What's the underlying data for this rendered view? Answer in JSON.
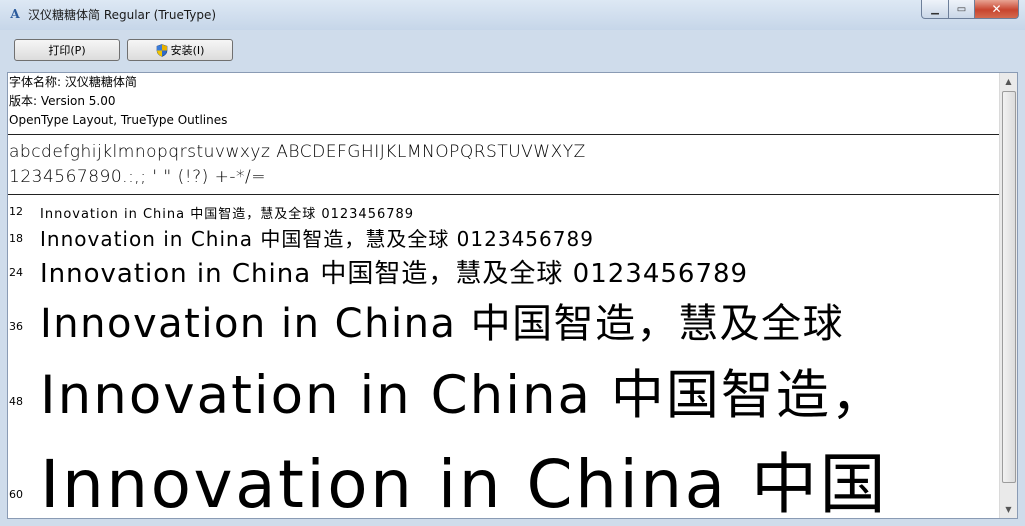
{
  "window": {
    "title": "汉仪糖糖体简 Regular (TrueType)",
    "minimize_glyph": "▁",
    "maximize_glyph": "▭",
    "close_glyph": "✕"
  },
  "toolbar": {
    "print_label": "打印(P)",
    "install_label": "安装(I)"
  },
  "info": {
    "font_name": "字体名称: 汉仪糖糖体简",
    "version": "版本: Version 5.00",
    "outlines": "OpenType Layout, TrueType Outlines"
  },
  "charset": {
    "line1": "abcdefghijklmnopqrstuvwxyz ABCDEFGHIJKLMNOPQRSTUVWXYZ",
    "line2": "1234567890.:,; ' \" (!?) +-*/="
  },
  "samples": [
    {
      "size": "12",
      "text": "Innovation in China 中国智造，慧及全球 0123456789"
    },
    {
      "size": "18",
      "text": "Innovation in China 中国智造，慧及全球 0123456789"
    },
    {
      "size": "24",
      "text": "Innovation in China 中国智造，慧及全球 0123456789"
    },
    {
      "size": "36",
      "text": "Innovation in China 中国智造，慧及全球"
    },
    {
      "size": "48",
      "text": "Innovation in China 中国智造，"
    },
    {
      "size": "60",
      "text": "Innovation in China 中国"
    }
  ],
  "scrollbar": {
    "up_glyph": "▲",
    "down_glyph": "▼"
  }
}
